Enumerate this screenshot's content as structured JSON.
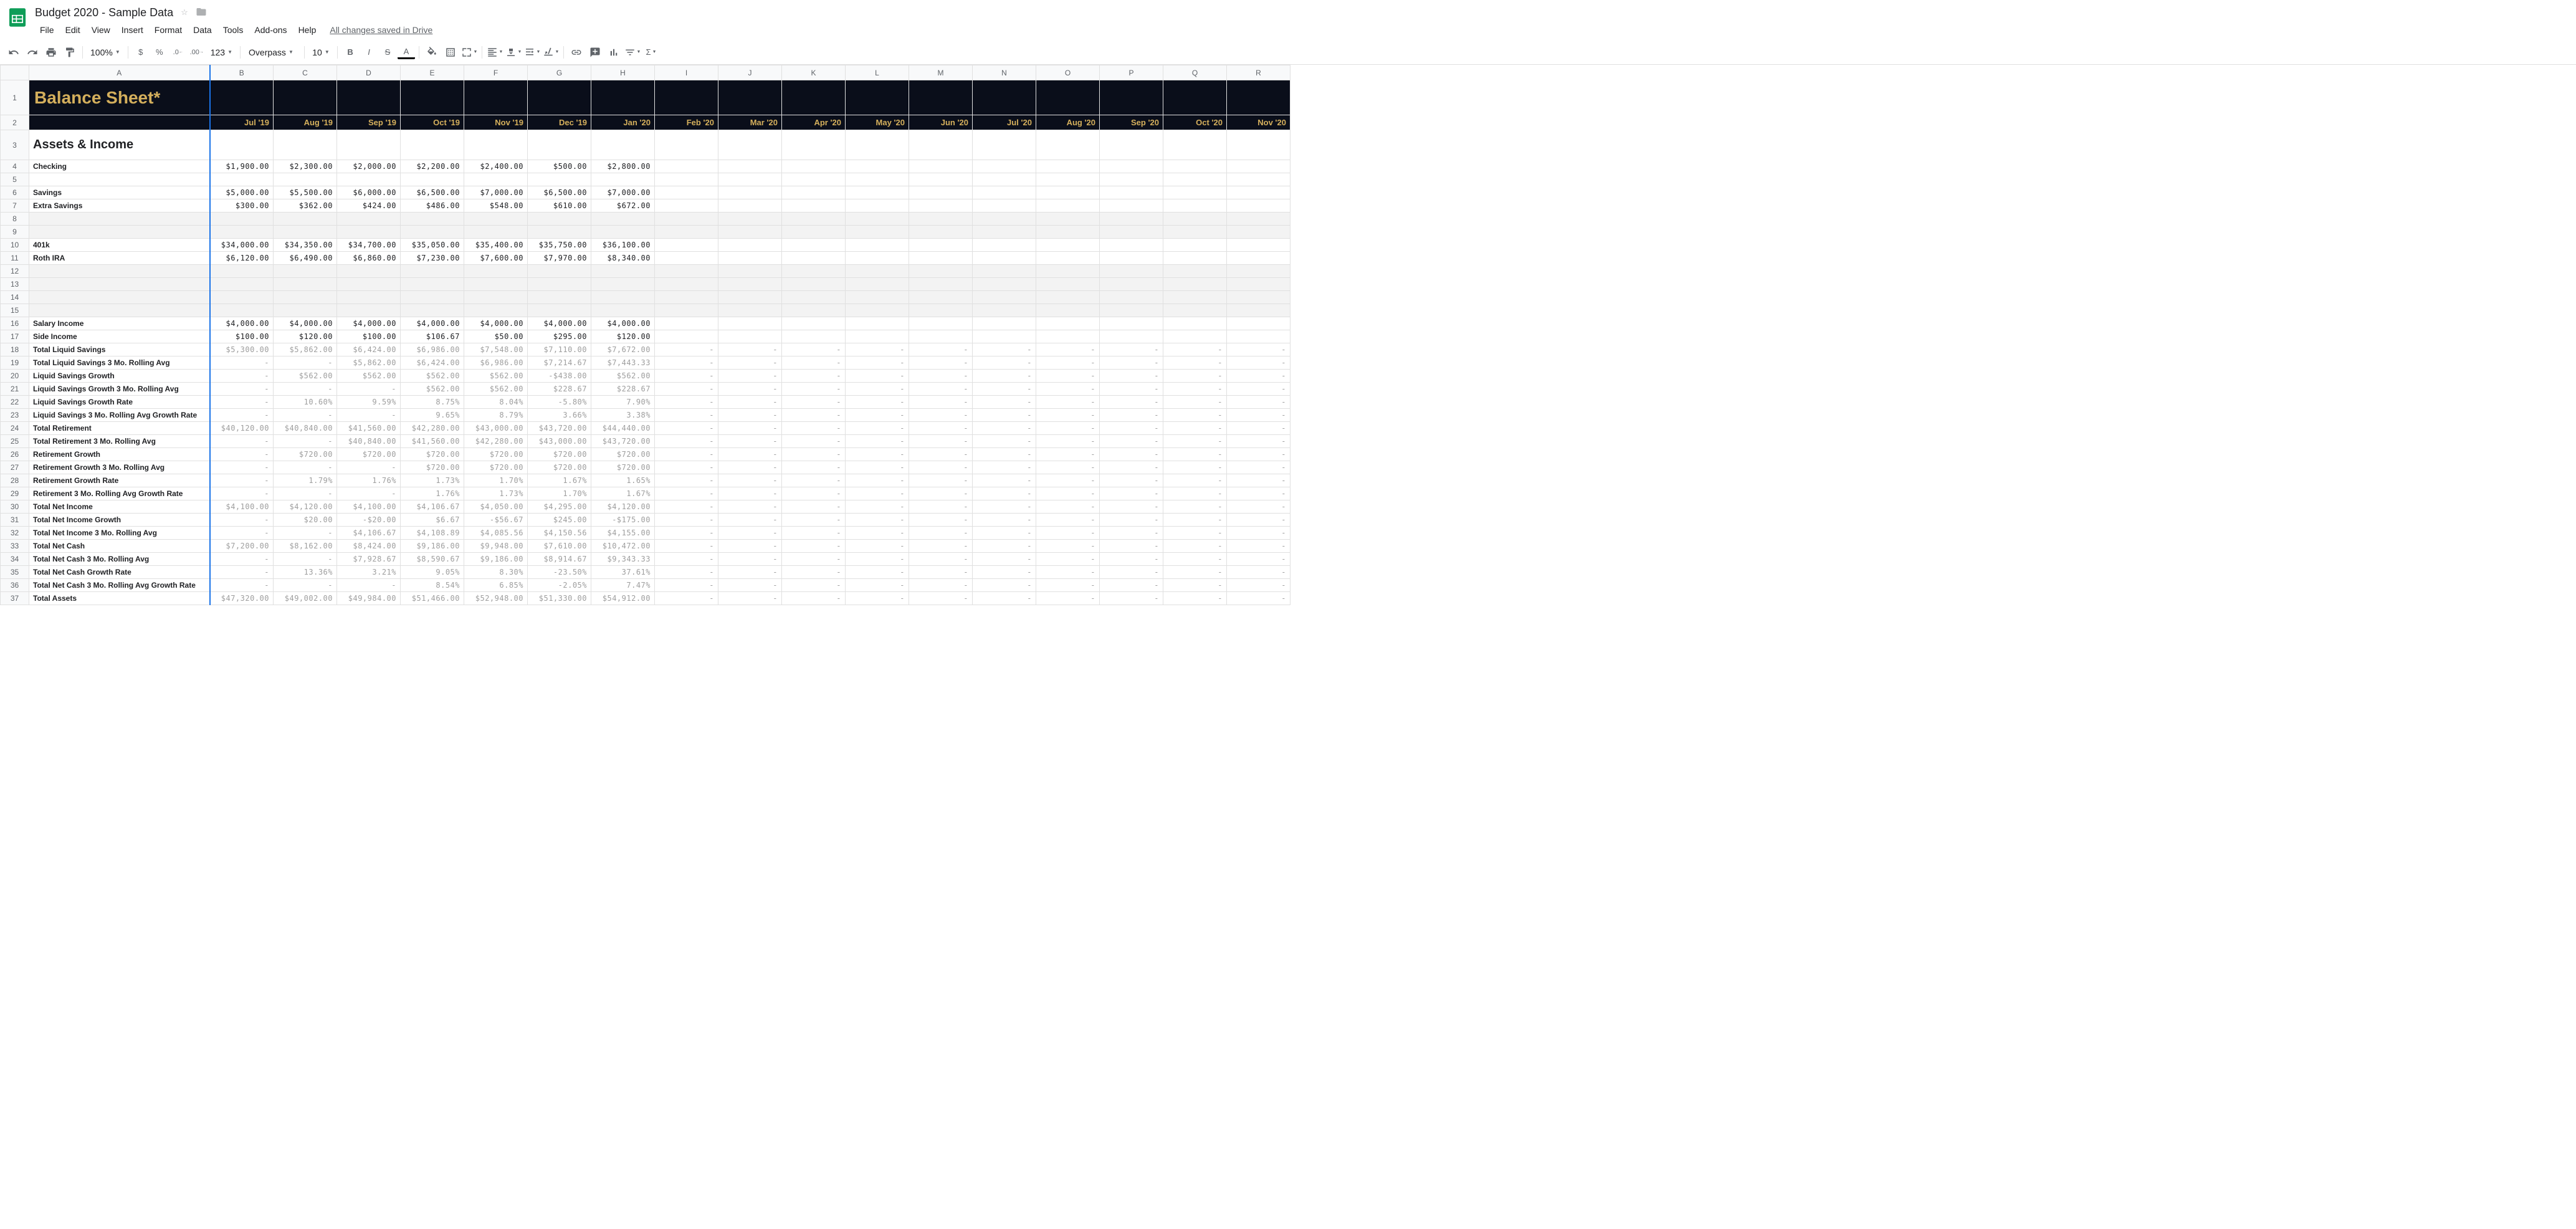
{
  "doc": {
    "title": "Budget 2020 - Sample Data"
  },
  "menus": [
    "File",
    "Edit",
    "View",
    "Insert",
    "Format",
    "Data",
    "Tools",
    "Add-ons",
    "Help"
  ],
  "save_status": "All changes saved in Drive",
  "toolbar": {
    "zoom": "100%",
    "font": "Overpass",
    "size": "10"
  },
  "columns": [
    "A",
    "B",
    "C",
    "D",
    "E",
    "F",
    "G",
    "H",
    "I",
    "J",
    "K",
    "L",
    "M",
    "N",
    "O",
    "P",
    "Q",
    "R"
  ],
  "title_cell": "Balance Sheet*",
  "months": [
    "Jul '19",
    "Aug '19",
    "Sep '19",
    "Oct '19",
    "Nov '19",
    "Dec '19",
    "Jan '20",
    "Feb '20",
    "Mar '20",
    "Apr '20",
    "May '20",
    "Jun '20",
    "Jul '20",
    "Aug '20",
    "Sep '20",
    "Oct '20",
    "Nov '20"
  ],
  "section_header": "Assets & Income",
  "chart_data": {
    "type": "table",
    "columns": [
      "Jul '19",
      "Aug '19",
      "Sep '19",
      "Oct '19",
      "Nov '19",
      "Dec '19",
      "Jan '20"
    ],
    "rows": [
      {
        "label": "Checking",
        "values": [
          "$1,900.00",
          "$2,300.00",
          "$2,000.00",
          "$2,200.00",
          "$2,400.00",
          "$500.00",
          "$2,800.00"
        ]
      },
      {
        "label": "Savings",
        "values": [
          "$5,000.00",
          "$5,500.00",
          "$6,000.00",
          "$6,500.00",
          "$7,000.00",
          "$6,500.00",
          "$7,000.00"
        ]
      },
      {
        "label": "Extra Savings",
        "values": [
          "$300.00",
          "$362.00",
          "$424.00",
          "$486.00",
          "$548.00",
          "$610.00",
          "$672.00"
        ]
      },
      {
        "label": "401k",
        "values": [
          "$34,000.00",
          "$34,350.00",
          "$34,700.00",
          "$35,050.00",
          "$35,400.00",
          "$35,750.00",
          "$36,100.00"
        ]
      },
      {
        "label": "Roth IRA",
        "values": [
          "$6,120.00",
          "$6,490.00",
          "$6,860.00",
          "$7,230.00",
          "$7,600.00",
          "$7,970.00",
          "$8,340.00"
        ]
      },
      {
        "label": "Salary Income",
        "values": [
          "$4,000.00",
          "$4,000.00",
          "$4,000.00",
          "$4,000.00",
          "$4,000.00",
          "$4,000.00",
          "$4,000.00"
        ]
      },
      {
        "label": "Side Income",
        "values": [
          "$100.00",
          "$120.00",
          "$100.00",
          "$106.67",
          "$50.00",
          "$295.00",
          "$120.00"
        ]
      },
      {
        "label": "Total Liquid Savings",
        "values": [
          "$5,300.00",
          "$5,862.00",
          "$6,424.00",
          "$6,986.00",
          "$7,548.00",
          "$7,110.00",
          "$7,672.00"
        ]
      },
      {
        "label": "Total Liquid Savings 3 Mo. Rolling Avg",
        "values": [
          "-",
          "-",
          "$5,862.00",
          "$6,424.00",
          "$6,986.00",
          "$7,214.67",
          "$7,443.33"
        ]
      },
      {
        "label": "Liquid Savings Growth",
        "values": [
          "-",
          "$562.00",
          "$562.00",
          "$562.00",
          "$562.00",
          "-$438.00",
          "$562.00"
        ]
      },
      {
        "label": "Liquid Savings Growth 3 Mo. Rolling Avg",
        "values": [
          "-",
          "-",
          "-",
          "$562.00",
          "$562.00",
          "$228.67",
          "$228.67"
        ]
      },
      {
        "label": "Liquid Savings Growth Rate",
        "values": [
          "-",
          "10.60%",
          "9.59%",
          "8.75%",
          "8.04%",
          "-5.80%",
          "7.90%"
        ]
      },
      {
        "label": "Liquid Savings 3 Mo. Rolling Avg Growth Rate",
        "values": [
          "-",
          "-",
          "-",
          "9.65%",
          "8.79%",
          "3.66%",
          "3.38%"
        ]
      },
      {
        "label": "Total Retirement",
        "values": [
          "$40,120.00",
          "$40,840.00",
          "$41,560.00",
          "$42,280.00",
          "$43,000.00",
          "$43,720.00",
          "$44,440.00"
        ]
      },
      {
        "label": "Total Retirement 3 Mo. Rolling Avg",
        "values": [
          "-",
          "-",
          "$40,840.00",
          "$41,560.00",
          "$42,280.00",
          "$43,000.00",
          "$43,720.00"
        ]
      },
      {
        "label": "Retirement Growth",
        "values": [
          "-",
          "$720.00",
          "$720.00",
          "$720.00",
          "$720.00",
          "$720.00",
          "$720.00"
        ]
      },
      {
        "label": "Retirement Growth 3 Mo. Rolling Avg",
        "values": [
          "-",
          "-",
          "-",
          "$720.00",
          "$720.00",
          "$720.00",
          "$720.00"
        ]
      },
      {
        "label": "Retirement Growth Rate",
        "values": [
          "-",
          "1.79%",
          "1.76%",
          "1.73%",
          "1.70%",
          "1.67%",
          "1.65%"
        ]
      },
      {
        "label": "Retirement 3 Mo. Rolling Avg Growth Rate",
        "values": [
          "-",
          "-",
          "-",
          "1.76%",
          "1.73%",
          "1.70%",
          "1.67%"
        ]
      },
      {
        "label": "Total Net Income",
        "values": [
          "$4,100.00",
          "$4,120.00",
          "$4,100.00",
          "$4,106.67",
          "$4,050.00",
          "$4,295.00",
          "$4,120.00"
        ]
      },
      {
        "label": "Total Net Income Growth",
        "values": [
          "-",
          "$20.00",
          "-$20.00",
          "$6.67",
          "-$56.67",
          "$245.00",
          "-$175.00"
        ]
      },
      {
        "label": "Total Net Income 3 Mo. Rolling Avg",
        "values": [
          "-",
          "-",
          "$4,106.67",
          "$4,108.89",
          "$4,085.56",
          "$4,150.56",
          "$4,155.00"
        ]
      },
      {
        "label": "Total Net Cash",
        "values": [
          "$7,200.00",
          "$8,162.00",
          "$8,424.00",
          "$9,186.00",
          "$9,948.00",
          "$7,610.00",
          "$10,472.00"
        ]
      },
      {
        "label": "Total Net Cash 3 Mo. Rolling Avg",
        "values": [
          "-",
          "-",
          "$7,928.67",
          "$8,590.67",
          "$9,186.00",
          "$8,914.67",
          "$9,343.33"
        ]
      },
      {
        "label": "Total Net Cash Growth Rate",
        "values": [
          "-",
          "13.36%",
          "3.21%",
          "9.05%",
          "8.30%",
          "-23.50%",
          "37.61%"
        ]
      },
      {
        "label": "Total Net Cash 3 Mo. Rolling Avg Growth Rate",
        "values": [
          "-",
          "-",
          "-",
          "8.54%",
          "6.85%",
          "-2.05%",
          "7.47%"
        ]
      },
      {
        "label": "Total Assets",
        "values": [
          "$47,320.00",
          "$49,002.00",
          "$49,984.00",
          "$51,466.00",
          "$52,948.00",
          "$51,330.00",
          "$54,912.00"
        ]
      }
    ]
  },
  "row_layout": [
    {
      "r": 4,
      "type": "data",
      "idx": 0,
      "bold": true
    },
    {
      "r": 5,
      "type": "empty"
    },
    {
      "r": 6,
      "type": "data",
      "idx": 1,
      "bold": true
    },
    {
      "r": 7,
      "type": "data",
      "idx": 2,
      "bold": true
    },
    {
      "r": 8,
      "type": "empty",
      "filled": true
    },
    {
      "r": 9,
      "type": "empty",
      "filled": true
    },
    {
      "r": 10,
      "type": "data",
      "idx": 3,
      "bold": true
    },
    {
      "r": 11,
      "type": "data",
      "idx": 4,
      "bold": true
    },
    {
      "r": 12,
      "type": "empty",
      "filled": true
    },
    {
      "r": 13,
      "type": "empty",
      "filled": true
    },
    {
      "r": 14,
      "type": "empty",
      "filled": true
    },
    {
      "r": 15,
      "type": "empty",
      "filled": true
    },
    {
      "r": 16,
      "type": "data",
      "idx": 5,
      "bold": true
    },
    {
      "r": 17,
      "type": "data",
      "idx": 6,
      "bold": true
    },
    {
      "r": 18,
      "type": "data",
      "idx": 7,
      "bold": true,
      "gray": true
    },
    {
      "r": 19,
      "type": "data",
      "idx": 8,
      "bold": true,
      "gray": true
    },
    {
      "r": 20,
      "type": "data",
      "idx": 9,
      "bold": true,
      "gray": true
    },
    {
      "r": 21,
      "type": "data",
      "idx": 10,
      "bold": true,
      "gray": true
    },
    {
      "r": 22,
      "type": "data",
      "idx": 11,
      "bold": true,
      "gray": true
    },
    {
      "r": 23,
      "type": "data",
      "idx": 12,
      "bold": true,
      "gray": true
    },
    {
      "r": 24,
      "type": "data",
      "idx": 13,
      "bold": true,
      "gray": true
    },
    {
      "r": 25,
      "type": "data",
      "idx": 14,
      "bold": true,
      "gray": true
    },
    {
      "r": 26,
      "type": "data",
      "idx": 15,
      "bold": true,
      "gray": true
    },
    {
      "r": 27,
      "type": "data",
      "idx": 16,
      "bold": true,
      "gray": true
    },
    {
      "r": 28,
      "type": "data",
      "idx": 17,
      "bold": true,
      "gray": true
    },
    {
      "r": 29,
      "type": "data",
      "idx": 18,
      "bold": true,
      "gray": true
    },
    {
      "r": 30,
      "type": "data",
      "idx": 19,
      "bold": true,
      "gray": true
    },
    {
      "r": 31,
      "type": "data",
      "idx": 20,
      "bold": true,
      "gray": true
    },
    {
      "r": 32,
      "type": "data",
      "idx": 21,
      "bold": true,
      "gray": true
    },
    {
      "r": 33,
      "type": "data",
      "idx": 22,
      "bold": true,
      "gray": true
    },
    {
      "r": 34,
      "type": "data",
      "idx": 23,
      "bold": true,
      "gray": true
    },
    {
      "r": 35,
      "type": "data",
      "idx": 24,
      "bold": true,
      "gray": true
    },
    {
      "r": 36,
      "type": "data",
      "idx": 25,
      "bold": true,
      "gray": true
    },
    {
      "r": 37,
      "type": "data",
      "idx": 26,
      "bold": true,
      "gray": true
    }
  ]
}
